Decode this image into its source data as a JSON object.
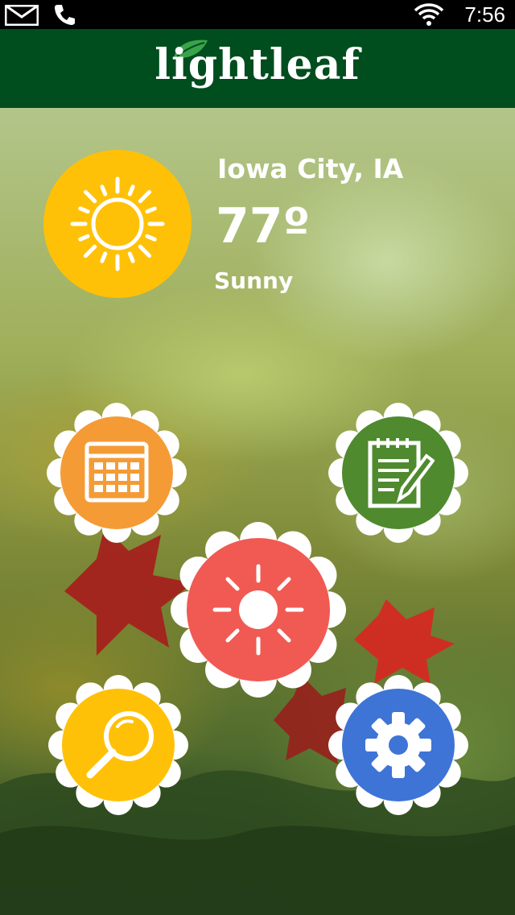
{
  "status_bar": {
    "time": "7:56"
  },
  "header": {
    "app_name": "lightleaf"
  },
  "weather": {
    "city": "Iowa City, IA",
    "temperature": "77º",
    "condition": "Sunny"
  },
  "tiles": [
    {
      "name": "calendar",
      "color": "#f59b35"
    },
    {
      "name": "notes",
      "color": "#4f8a2e"
    },
    {
      "name": "weather",
      "color": "#f05a52"
    },
    {
      "name": "search",
      "color": "#ffc107"
    },
    {
      "name": "settings",
      "color": "#3e74d6"
    }
  ],
  "colors": {
    "header": "#004d1e",
    "sun_badge": "#ffc107"
  }
}
